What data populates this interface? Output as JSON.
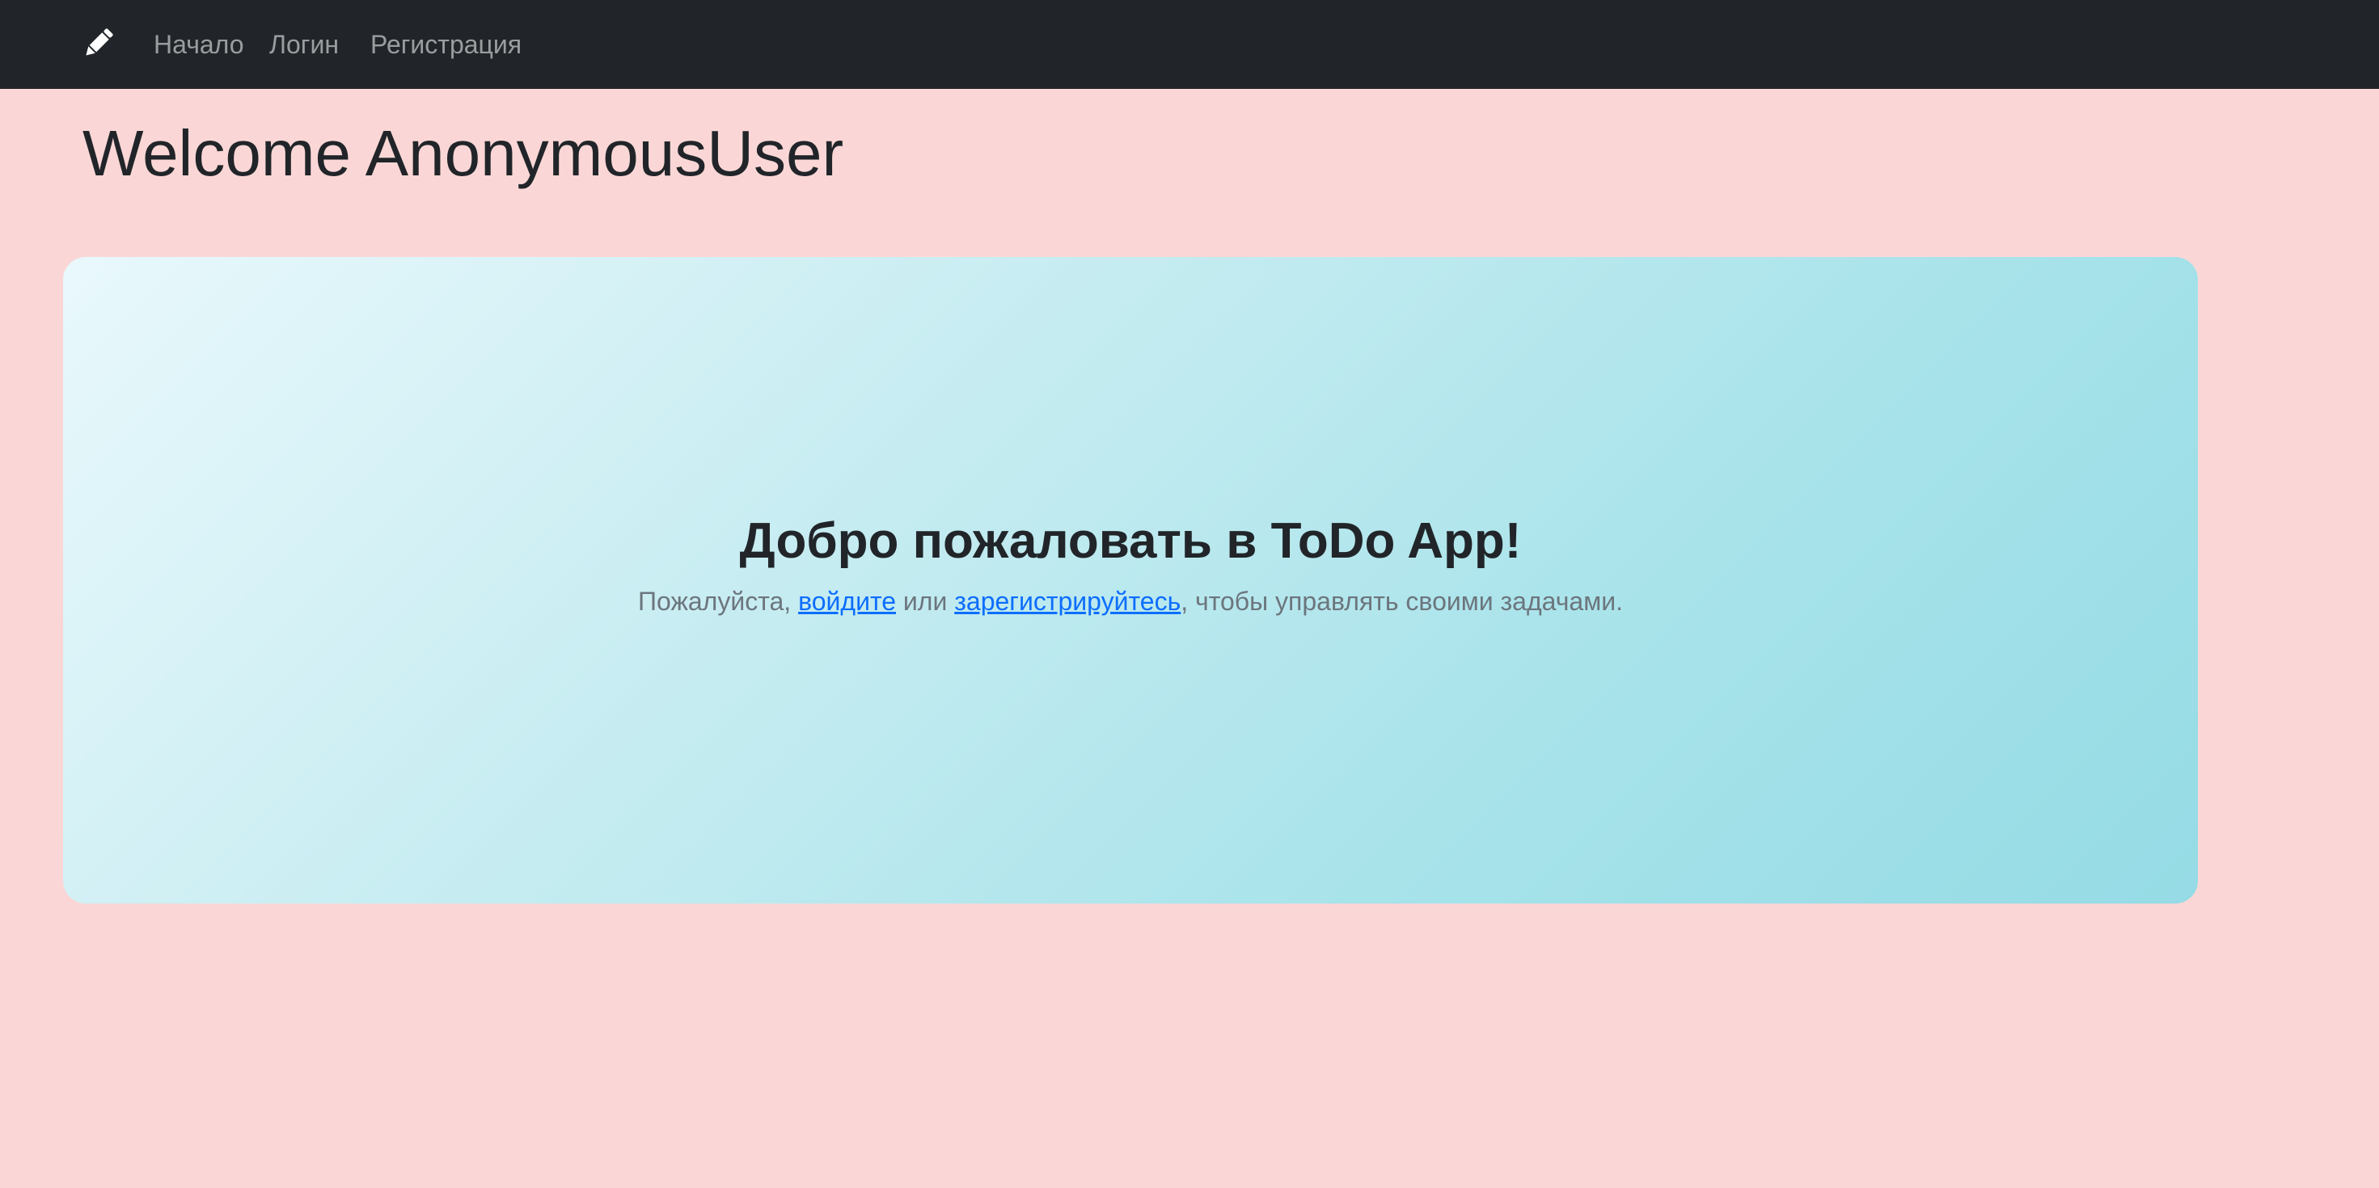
{
  "navbar": {
    "brand_icon": "pencil-icon",
    "items": [
      {
        "label": "Начало"
      },
      {
        "label": "Логин"
      },
      {
        "label": "Регистрация"
      }
    ],
    "background": "#212529",
    "link_color": "rgba(255,255,255,0.55)"
  },
  "page": {
    "welcome_title": "Welcome AnonymousUser",
    "background": "#fad7d6"
  },
  "hero": {
    "title": "Добро пожаловать в ToDo App!",
    "text_before": "Пожалуйста, ",
    "login_link": "войдите",
    "text_middle": " или ",
    "register_link": "зарегистрируйтесь",
    "text_after": ", чтобы управлять своими задачами.",
    "gradient_start": "#e9f8fc",
    "gradient_end": "#95dbe5",
    "link_color": "#0d6efd"
  }
}
